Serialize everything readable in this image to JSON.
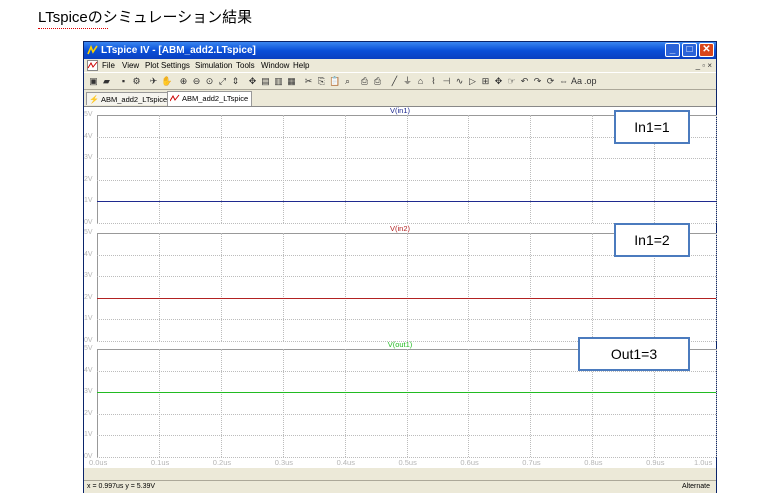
{
  "caption": "LTspiceのシミュレーション結果",
  "window": {
    "title": "LTspice IV - [ABM_add2.LTspice]",
    "controls": {
      "minimize": "_",
      "maximize": "□",
      "close": "✕"
    }
  },
  "menubar": {
    "items": [
      "File",
      "View",
      "Plot Settings",
      "Simulation",
      "Tools",
      "Window",
      "Help"
    ],
    "mdi_controls": "_ ▫ ×"
  },
  "toolbar": {
    "icons": [
      "new-schematic-icon",
      "open-icon",
      "save-icon",
      "control-panel-icon",
      "run-icon",
      "halt-icon",
      "zoom-in-icon",
      "zoom-out-icon",
      "zoom-area-icon",
      "zoom-fit-icon",
      "autorange-icon",
      "pan-icon",
      "tile-horizontal-icon",
      "tile-vertical-icon",
      "cascade-icon",
      "cut-icon",
      "copy-icon",
      "paste-icon",
      "find-icon",
      "print-preview-icon",
      "print-icon",
      "wire-icon",
      "ground-icon",
      "label-icon",
      "resistor-icon",
      "capacitor-icon",
      "inductor-icon",
      "diode-icon",
      "component-icon",
      "move-icon",
      "drag-icon",
      "undo-icon",
      "redo-icon",
      "rotate-icon",
      "mirror-icon",
      "text-icon",
      "spice-directive-icon"
    ]
  },
  "tabs": [
    {
      "label": "ABM_add2_LTspice",
      "active": false
    },
    {
      "label": "ABM_add2_LTspice",
      "active": true
    }
  ],
  "panes": [
    {
      "title": "V(in1)",
      "color": "#1f2a8f",
      "value": 1,
      "annotation": "In1=1",
      "yticks": [
        "5V",
        "4V",
        "3V",
        "2V",
        "1V",
        "0V"
      ]
    },
    {
      "title": "V(in2)",
      "color": "#b22222",
      "value": 2,
      "annotation": "In1=2",
      "yticks": [
        "5V",
        "4V",
        "3V",
        "2V",
        "1V",
        "0V"
      ]
    },
    {
      "title": "V(out1)",
      "color": "#22bb22",
      "value": 3,
      "annotation": "Out1=3",
      "yticks": [
        "5V",
        "4V",
        "3V",
        "2V",
        "1V",
        "0V"
      ]
    }
  ],
  "xaxis": {
    "ticks": [
      "0.0us",
      "0.1us",
      "0.2us",
      "0.3us",
      "0.4us",
      "0.5us",
      "0.6us",
      "0.7us",
      "0.8us",
      "0.9us",
      "1.0us"
    ]
  },
  "chart_data": {
    "type": "line",
    "x": [
      0,
      1
    ],
    "xlim": [
      0,
      1.0
    ],
    "ylim": [
      0,
      5
    ],
    "series": [
      {
        "name": "V(in1)",
        "values": [
          1,
          1
        ]
      },
      {
        "name": "V(in2)",
        "values": [
          2,
          2
        ]
      },
      {
        "name": "V(out1)",
        "values": [
          3,
          3
        ]
      }
    ],
    "grid": true
  },
  "statusbar": {
    "cursor": "x = 0.997us    y = 5.39V",
    "mode": "Alternate"
  }
}
